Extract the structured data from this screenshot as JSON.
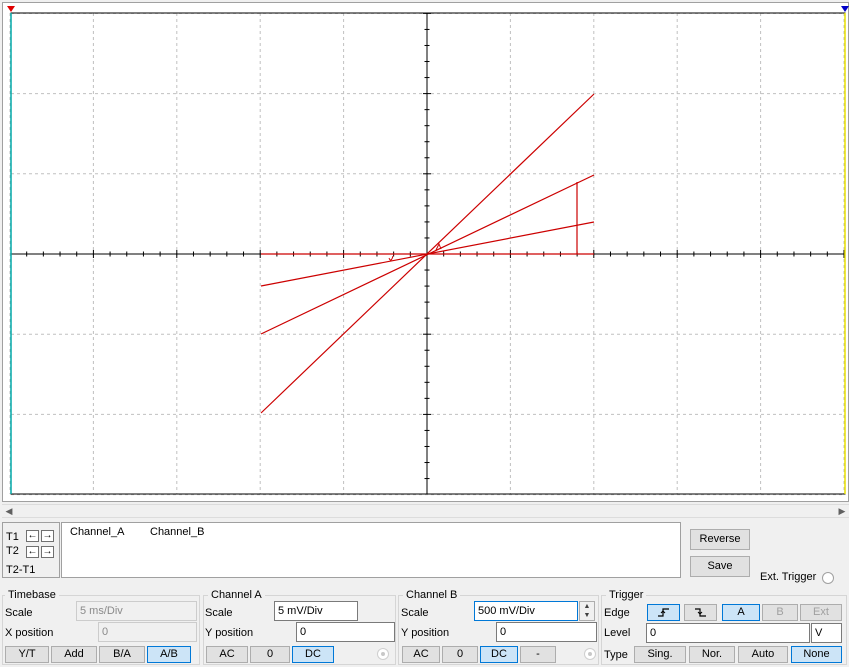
{
  "colors": {
    "trace": "#cc0000",
    "grid": "#c0c0c0",
    "axis": "#000000",
    "cursor1": "#00a8a8",
    "cursor2": "#e8e000",
    "marker1": "#e00000",
    "marker2": "#0000c8",
    "active_accent": "#0078d7"
  },
  "cursors": {
    "t1_label": "T1",
    "t2_label": "T2",
    "t2t1_label": "T2-T1"
  },
  "readout": {
    "col_a": "Channel_A",
    "col_b": "Channel_B"
  },
  "buttons": {
    "reverse": "Reverse",
    "save": "Save",
    "ext_trigger": "Ext. Trigger"
  },
  "timebase": {
    "title": "Timebase",
    "scale_label": "Scale",
    "scale_value": "5 ms/Div",
    "xpos_label": "X position",
    "xpos_value": "0",
    "modes": [
      "Y/T",
      "Add",
      "B/A",
      "A/B"
    ],
    "active_mode": "A/B"
  },
  "channel_a": {
    "title": "Channel A",
    "scale_label": "Scale",
    "scale_value": "5 mV/Div",
    "ypos_label": "Y position",
    "ypos_value": "0",
    "coupling": [
      "AC",
      "0",
      "DC"
    ],
    "active_coupling": "DC"
  },
  "channel_b": {
    "title": "Channel B",
    "scale_label": "Scale",
    "scale_value": "500 mV/Div",
    "ypos_label": "Y position",
    "ypos_value": "0",
    "coupling": [
      "AC",
      "0",
      "DC",
      "-"
    ],
    "active_coupling": "DC"
  },
  "trigger": {
    "title": "Trigger",
    "edge_label": "Edge",
    "edge_rising": "rising-edge-icon",
    "edge_falling": "falling-edge-icon",
    "sources": [
      "A",
      "B",
      "Ext"
    ],
    "active_source": "A",
    "level_label": "Level",
    "level_value": "0",
    "level_unit": "V",
    "type_label": "Type",
    "types": [
      "Sing.",
      "Nor.",
      "Auto",
      "None"
    ],
    "active_type": "None"
  }
}
